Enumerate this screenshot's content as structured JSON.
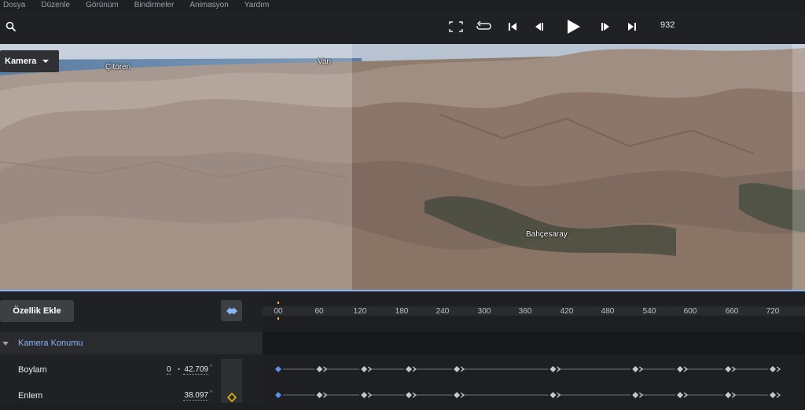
{
  "menu": [
    "Dosya",
    "Düzenle",
    "Görünüm",
    "Bindirmeler",
    "Animasyon",
    "Yardım"
  ],
  "toolbar": {
    "frame": "932"
  },
  "icons": {
    "search": "search-icon",
    "fullscreen": "fullscreen-icon",
    "loop": "loop-icon",
    "skip_start": "skip-start-icon",
    "step_back": "step-back-icon",
    "play": "play-icon",
    "step_forward": "step-forward-icon",
    "skip_end": "skip-end-icon",
    "keyframe_toggle": "keyframe-nav-icon",
    "keyframe_add": "add-keyframe-icon"
  },
  "viewport": {
    "camera_label": "Kamera",
    "places": [
      "Çitören",
      "Van",
      "Bahçesaray"
    ]
  },
  "panel": {
    "add_property_label": "Özellik Ekle",
    "section_title": "Kamera Konumu",
    "properties": [
      {
        "label": "Boylam",
        "value": "42.709",
        "prefix": "0",
        "unit": "°"
      },
      {
        "label": "Enlem",
        "value": "38.097",
        "unit": "°"
      }
    ]
  },
  "timeline": {
    "ticks": [
      "00",
      "60",
      "120",
      "180",
      "240",
      "300",
      "360",
      "420",
      "480",
      "540",
      "600",
      "660",
      "720"
    ],
    "keyframes_frames": [
      0,
      60,
      125,
      190,
      260,
      400,
      520,
      585,
      655,
      720
    ],
    "current_frame": 0
  },
  "colors": {
    "accent": "#8ab4f8",
    "keyframe": "#c8c8c8",
    "keyframe_selected": "#5a94e6",
    "highlight": "#fbbc04"
  }
}
